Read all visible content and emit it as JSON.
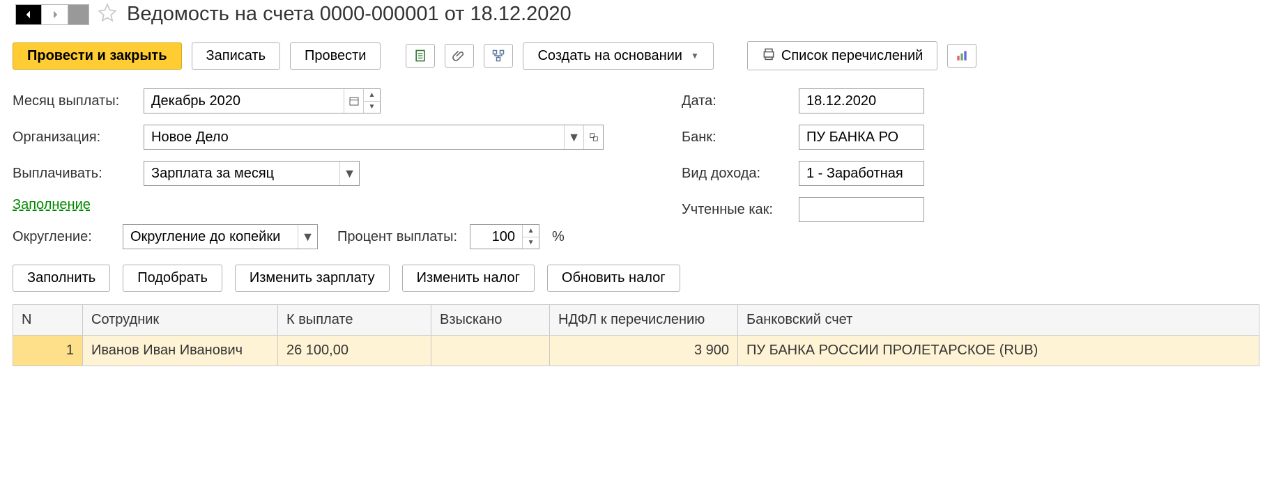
{
  "title": "Ведомость на счета 0000-000001 от 18.12.2020",
  "toolbar": {
    "post_close": "Провести и закрыть",
    "save": "Записать",
    "post": "Провести",
    "create_based": "Создать на основании",
    "transfer_list": "Список перечислений"
  },
  "fields": {
    "month_label": "Месяц выплаты:",
    "month_value": "Декабрь 2020",
    "org_label": "Организация:",
    "org_value": "Новое Дело",
    "pay_label": "Выплачивать:",
    "pay_value": "Зарплата за месяц",
    "fill_link": "Заполнение",
    "round_label": "Округление:",
    "round_value": "Округление до копейки",
    "percent_label": "Процент выплаты:",
    "percent_value": "100",
    "percent_suffix": "%",
    "date_label": "Дата:",
    "date_value": "18.12.2020",
    "bank_label": "Банк:",
    "bank_value": "ПУ БАНКА РО",
    "income_label": "Вид дохода:",
    "income_value": "1 - Заработная",
    "accounted_label": "Учтенные как:",
    "accounted_value": ""
  },
  "actions": {
    "fill": "Заполнить",
    "pick": "Подобрать",
    "change_salary": "Изменить зарплату",
    "change_tax": "Изменить налог",
    "update_tax": "Обновить налог"
  },
  "table": {
    "headers": {
      "n": "N",
      "employee": "Сотрудник",
      "to_pay": "К выплате",
      "withheld": "Взыскано",
      "ndfl": "НДФЛ к перечислению",
      "bank_acct": "Банковский счет"
    },
    "rows": [
      {
        "n": "1",
        "employee": "Иванов Иван Иванович",
        "to_pay": "26 100,00",
        "withheld": "",
        "ndfl": "3 900",
        "bank_acct": "ПУ БАНКА РОССИИ ПРОЛЕТАРСКОЕ (RUB)"
      }
    ]
  }
}
